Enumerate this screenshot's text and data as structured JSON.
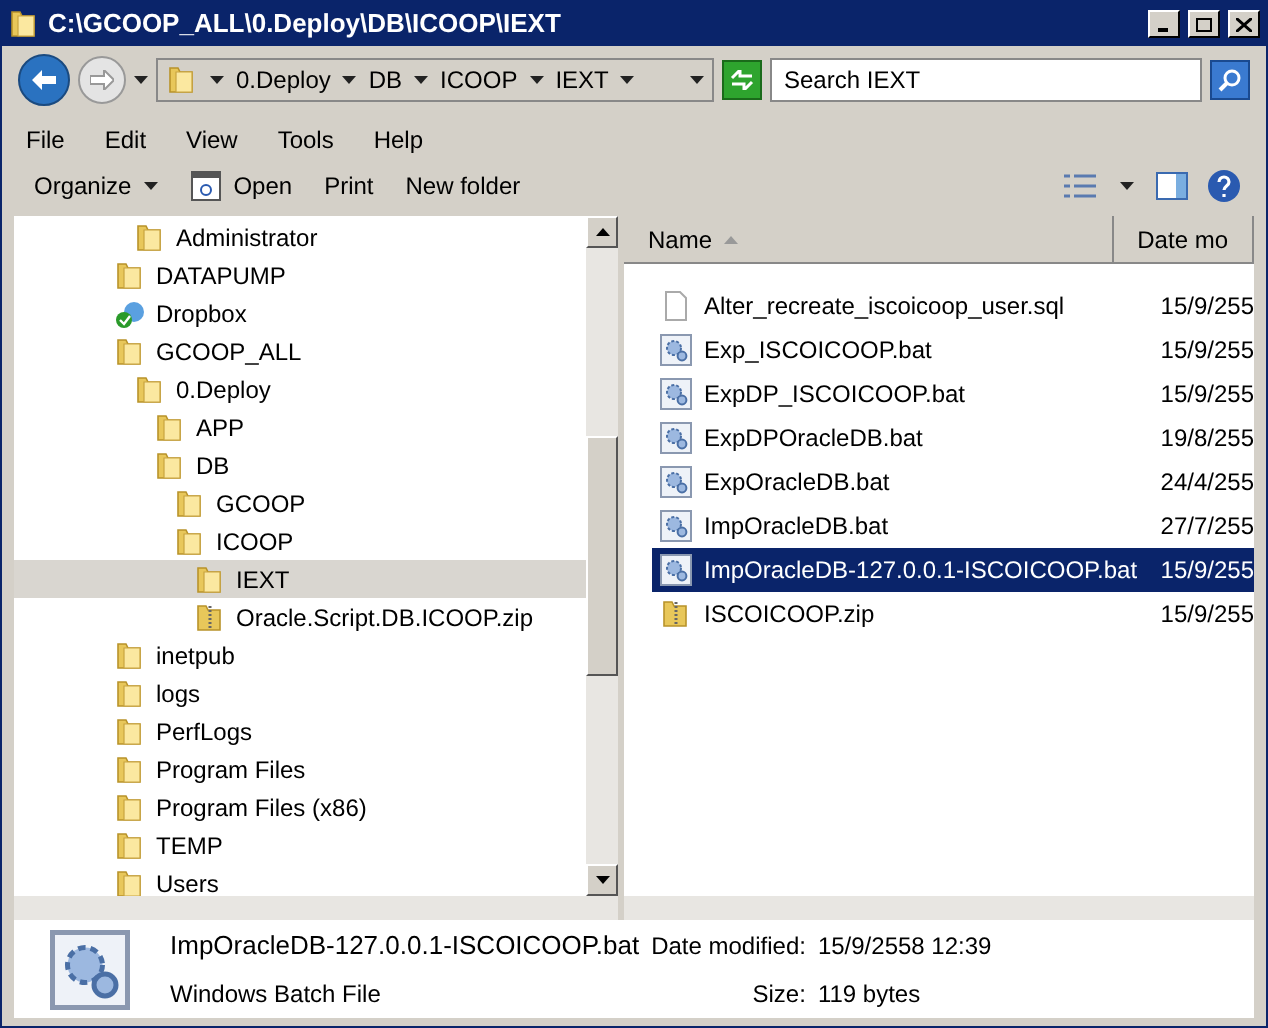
{
  "window": {
    "title": "C:\\GCOOP_ALL\\0.Deploy\\DB\\ICOOP\\IEXT"
  },
  "breadcrumb": [
    "0.Deploy",
    "DB",
    "ICOOP",
    "IEXT"
  ],
  "search": {
    "placeholder": "Search IEXT"
  },
  "menu": [
    "File",
    "Edit",
    "View",
    "Tools",
    "Help"
  ],
  "toolbar": [
    {
      "label": "Organize",
      "kind": "dropdown"
    },
    {
      "label": "Open",
      "kind": "open"
    },
    {
      "label": "Print",
      "kind": "plain"
    },
    {
      "label": "New folder",
      "kind": "plain"
    }
  ],
  "tree": [
    {
      "children": [
        {
          "label": "Administrator",
          "kind": "folder",
          "selected": false
        }
      ]
    },
    {
      "label": "DATAPUMP",
      "kind": "folder",
      "selected": false
    },
    {
      "label": "Dropbox",
      "kind": "sync",
      "selected": false
    },
    {
      "label": "GCOOP_ALL",
      "kind": "folder",
      "selected": false,
      "children": [
        {
          "label": "0.Deploy",
          "kind": "folder",
          "selected": false,
          "children": [
            {
              "label": "APP",
              "kind": "folder",
              "selected": false
            },
            {
              "label": "DB",
              "kind": "folder",
              "selected": false,
              "children": [
                {
                  "label": "GCOOP",
                  "kind": "folder",
                  "selected": false
                },
                {
                  "label": "ICOOP",
                  "kind": "folder",
                  "selected": false,
                  "children": [
                    {
                      "label": "IEXT",
                      "kind": "folder",
                      "selected": true
                    },
                    {
                      "label": "Oracle.Script.DB.ICOOP.zip",
                      "kind": "zip",
                      "selected": false
                    }
                  ]
                }
              ]
            }
          ]
        }
      ]
    },
    {
      "label": "inetpub",
      "kind": "folder",
      "selected": false
    },
    {
      "label": "logs",
      "kind": "folder",
      "selected": false
    },
    {
      "label": "PerfLogs",
      "kind": "folder",
      "selected": false
    },
    {
      "label": "Program Files",
      "kind": "folder",
      "selected": false
    },
    {
      "label": "Program Files (x86)",
      "kind": "folder",
      "selected": false
    },
    {
      "label": "TEMP",
      "kind": "folder",
      "selected": false
    },
    {
      "label": "Users",
      "kind": "folder",
      "selected": false
    }
  ],
  "table": {
    "columns": [
      "Name",
      "Date mo"
    ],
    "rows": [
      {
        "name": "Alter_recreate_iscoicoop_user.sql",
        "date": "15/9/255",
        "kind": "sql",
        "selected": false
      },
      {
        "name": "Exp_ISCOICOOP.bat",
        "date": "15/9/255",
        "kind": "bat",
        "selected": false
      },
      {
        "name": "ExpDP_ISCOICOOP.bat",
        "date": "15/9/255",
        "kind": "bat",
        "selected": false
      },
      {
        "name": "ExpDPOracleDB.bat",
        "date": "19/8/255",
        "kind": "bat",
        "selected": false
      },
      {
        "name": "ExpOracleDB.bat",
        "date": "24/4/255",
        "kind": "bat",
        "selected": false
      },
      {
        "name": "ImpOracleDB.bat",
        "date": "27/7/255",
        "kind": "bat",
        "selected": false
      },
      {
        "name": "ImpOracleDB-127.0.0.1-ISCOICOOP.bat",
        "date": "15/9/255",
        "kind": "bat",
        "selected": true
      },
      {
        "name": "ISCOICOOP.zip",
        "date": "15/9/255",
        "kind": "zip",
        "selected": false
      }
    ]
  },
  "details": {
    "name": "ImpOracleDB-127.0.0.1-ISCOICOOP.bat",
    "type": "Windows Batch File",
    "date_label": "Date modified:",
    "date": "15/9/2558 12:39",
    "size_label": "Size:",
    "size": "119 bytes"
  }
}
